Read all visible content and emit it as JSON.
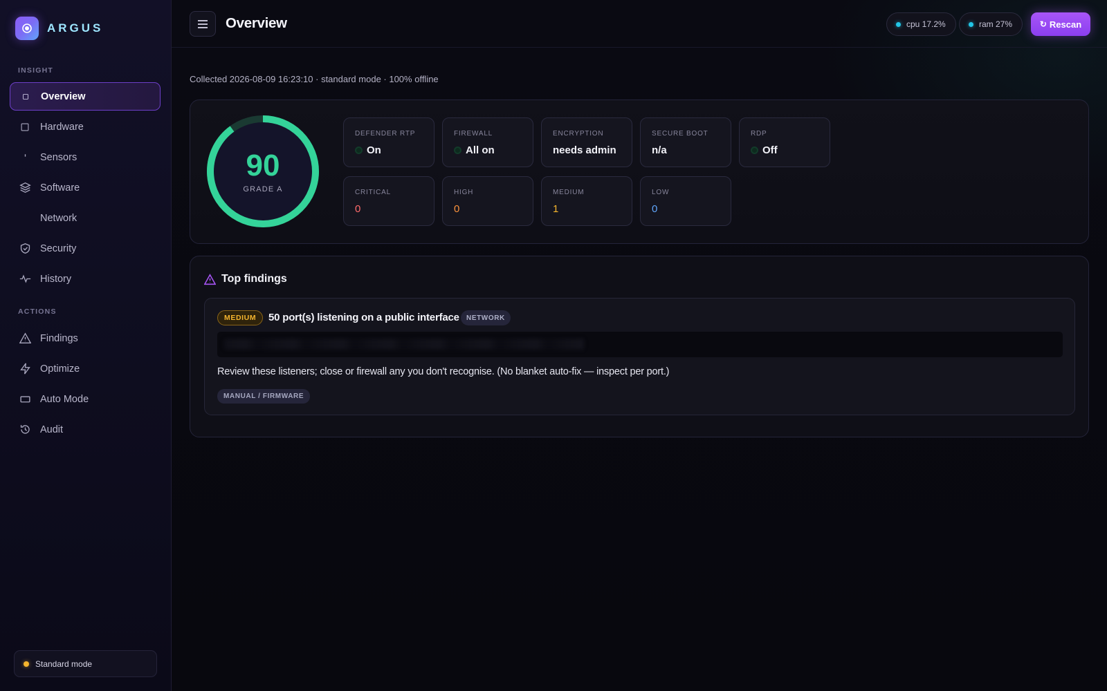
{
  "brand": {
    "name": "ARGUS"
  },
  "sidebar": {
    "sections": {
      "insight": "INSIGHT",
      "actions": "ACTIONS"
    },
    "insight_items": [
      {
        "label": "Overview",
        "icon": "overview-icon",
        "active": true
      },
      {
        "label": "Hardware",
        "icon": "hardware-icon"
      },
      {
        "label": "Sensors",
        "icon": "sensors-icon"
      },
      {
        "label": "Software",
        "icon": "layers-icon"
      },
      {
        "label": "Network",
        "icon": "network-icon"
      },
      {
        "label": "Security",
        "icon": "shield-icon"
      },
      {
        "label": "History",
        "icon": "activity-icon"
      }
    ],
    "action_items": [
      {
        "label": "Findings",
        "icon": "warning-icon"
      },
      {
        "label": "Optimize",
        "icon": "bolt-icon"
      },
      {
        "label": "Auto Mode",
        "icon": "auto-mode-icon"
      },
      {
        "label": "Audit",
        "icon": "history-icon"
      }
    ],
    "mode": {
      "label": "Standard mode",
      "color": "#f5b52e"
    }
  },
  "header": {
    "title": "Overview",
    "cpu": "cpu 17.2%",
    "ram": "ram 27%",
    "rescan_label": "Rescan"
  },
  "collected": "Collected 2026-08-09 16:23:10 · standard mode · 100% offline",
  "score": {
    "value": "90",
    "grade": "GRADE A",
    "fraction": 0.9,
    "color": "#34d399"
  },
  "status_tiles": [
    {
      "label": "DEFENDER RTP",
      "value": "On",
      "dot": true
    },
    {
      "label": "FIREWALL",
      "value": "All on",
      "dot": true
    },
    {
      "label": "ENCRYPTION",
      "value": "needs admin",
      "dot": false
    },
    {
      "label": "SECURE BOOT",
      "value": "n/a",
      "dot": false
    },
    {
      "label": "RDP",
      "value": "Off",
      "dot": true
    }
  ],
  "severity_tiles": [
    {
      "label": "CRITICAL",
      "value": "0",
      "color": "#ff6b6b"
    },
    {
      "label": "HIGH",
      "value": "0",
      "color": "#fb923c"
    },
    {
      "label": "MEDIUM",
      "value": "1",
      "color": "#f5b52e"
    },
    {
      "label": "LOW",
      "value": "0",
      "color": "#60a5fa"
    }
  ],
  "findings": {
    "title": "Top findings",
    "items": [
      {
        "severity": "MEDIUM",
        "title": "50 port(s) listening on a public interface",
        "category": "NETWORK",
        "description": "Review these listeners; close or firewall any you don't recognise. (No blanket auto-fix — inspect per port.)",
        "fix_type": "MANUAL / FIRMWARE"
      }
    ]
  }
}
